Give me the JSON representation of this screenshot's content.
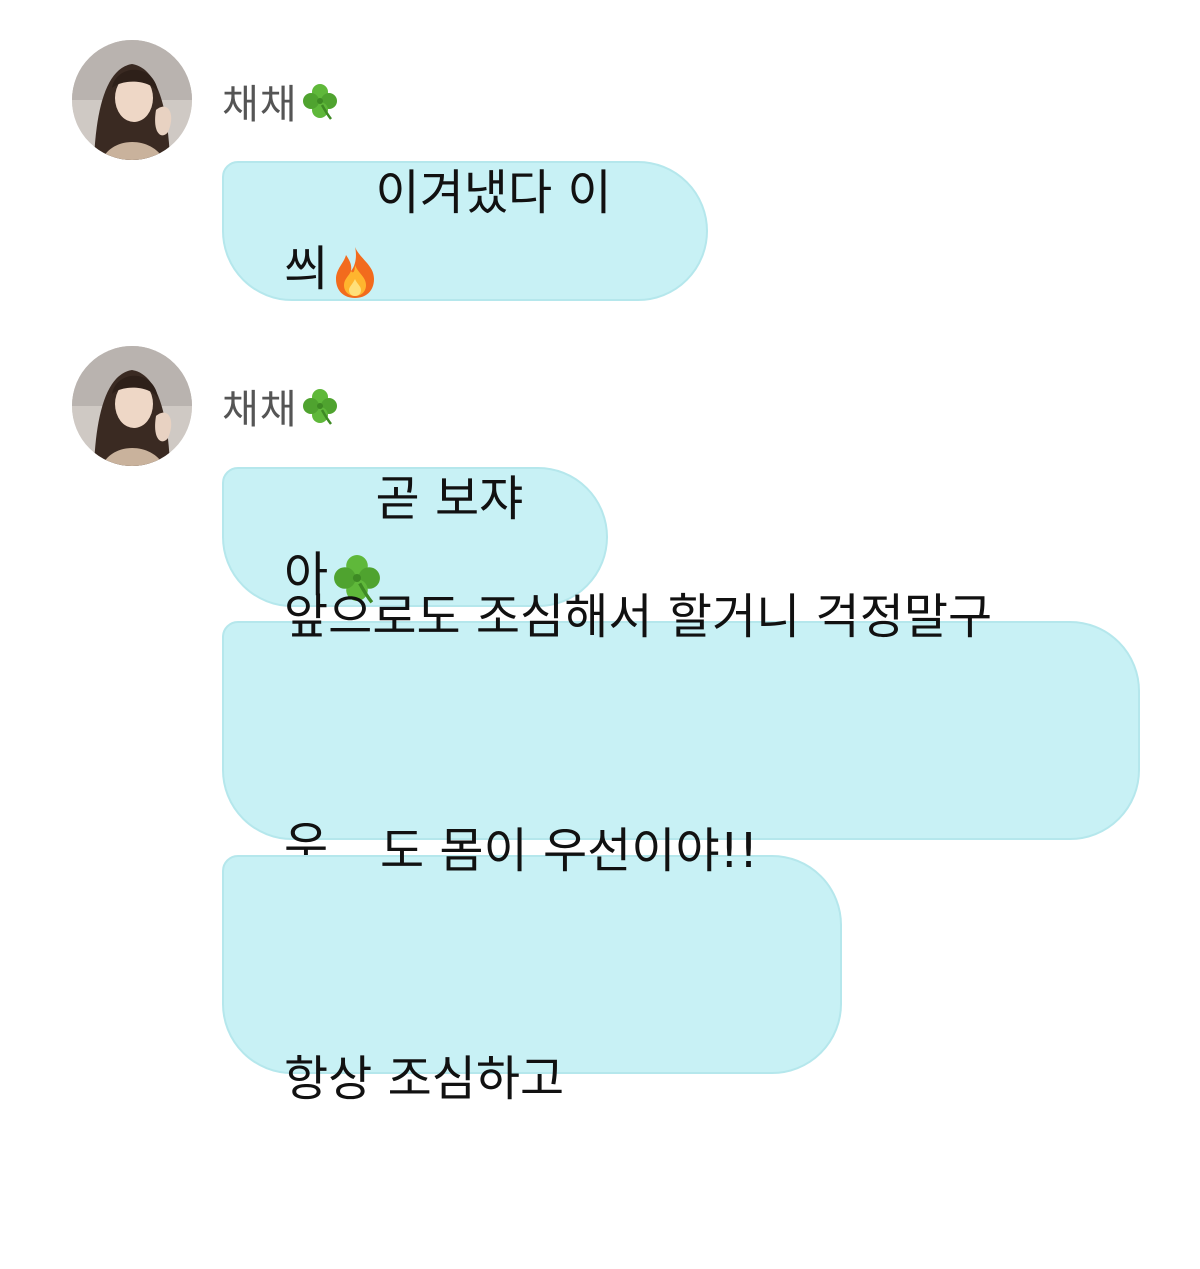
{
  "messages": [
    {
      "sender": "채채",
      "sender_emoji": "clover-icon",
      "bubbles": [
        {
          "lines": [
            "이겨냈다 이씌"
          ],
          "trailing_emoji": "fire-icon"
        }
      ]
    },
    {
      "sender": "채채",
      "sender_emoji": "clover-icon",
      "bubbles": [
        {
          "lines": [
            "곧 보쟈아"
          ],
          "trailing_emoji": "clover-icon"
        },
        {
          "lines": [
            "앞으로도 조심해서 할거니 걱정말구",
            "우"
          ]
        },
        {
          "lines": [
            "도 몸이 우선이야!!",
            "항상 조심하고"
          ]
        }
      ]
    }
  ],
  "colors": {
    "bubble_background": "#c8f1f5",
    "bubble_border": "#b5e7ec",
    "sender_name": "#555555",
    "message_text": "#111111"
  }
}
